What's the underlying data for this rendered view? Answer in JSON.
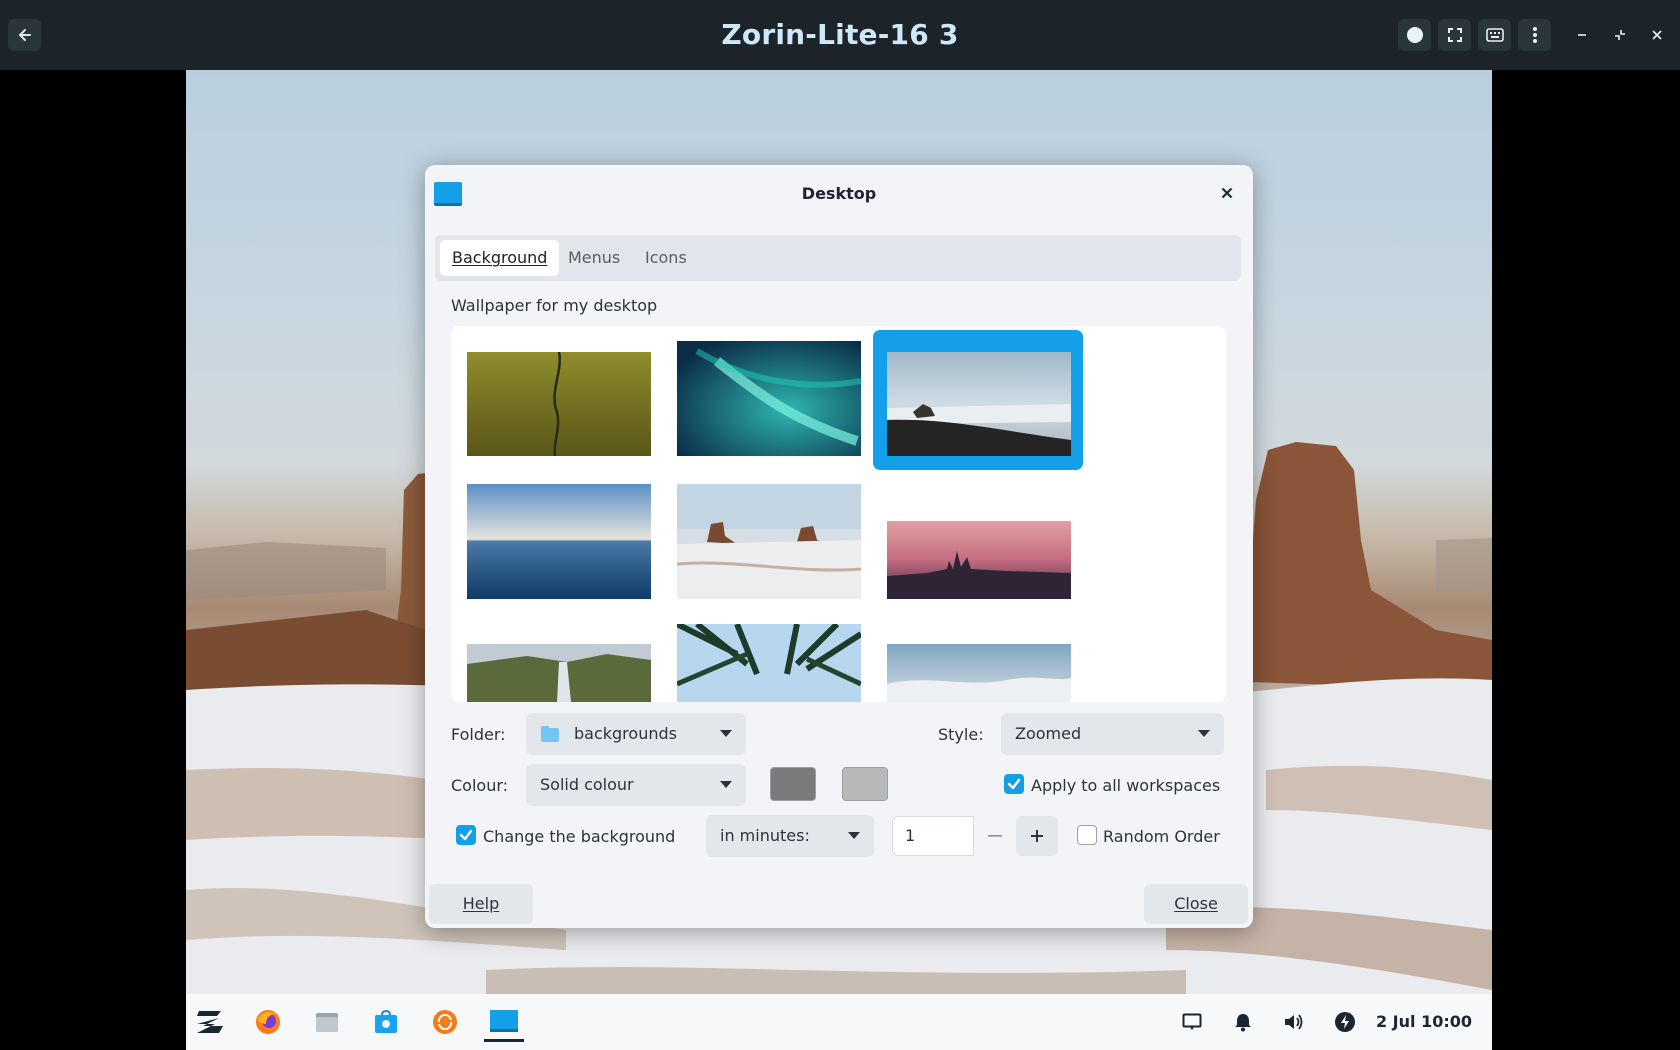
{
  "host": {
    "title": "Zorin-Lite-16 3",
    "buttons": [
      "back-arrow-icon",
      "record-dot-icon",
      "fullscreen-icon",
      "keyboard-icon",
      "kebab-menu-icon",
      "minimize-icon",
      "unmaximize-icon",
      "close-icon"
    ]
  },
  "dialog": {
    "title": "Desktop",
    "tabs": [
      {
        "label": "Background",
        "active": true
      },
      {
        "label": "Menus",
        "active": false
      },
      {
        "label": "Icons",
        "active": false
      }
    ],
    "wallpaper_label": "Wallpaper for my desktop",
    "selected_index": 2,
    "folder_label": "Folder:",
    "folder_value": "backgrounds",
    "style_label": "Style:",
    "style_value": "Zoomed",
    "colour_label": "Colour:",
    "colour_value": "Solid colour",
    "swatch_primary": "#7b7b7b",
    "swatch_secondary": "#b8b8b8",
    "apply_all_label": "Apply to all workspaces",
    "apply_all_checked": true,
    "change_bg_label": "Change the background",
    "change_bg_checked": true,
    "interval_value": "in minutes:",
    "spin_value": "1",
    "random_label": "Random Order",
    "random_checked": false,
    "help_label": "Help",
    "close_label": "Close"
  },
  "taskbar": {
    "apps": [
      "zorin-menu-icon",
      "firefox-icon",
      "files-icon",
      "software-store-icon",
      "update-icon",
      "desktop-settings-icon"
    ],
    "clock": "2 Jul 10:00"
  },
  "colors": {
    "accent": "#14a0e8",
    "host_bar": "#1c2429",
    "dialog_bg": "#f2f4f7"
  }
}
